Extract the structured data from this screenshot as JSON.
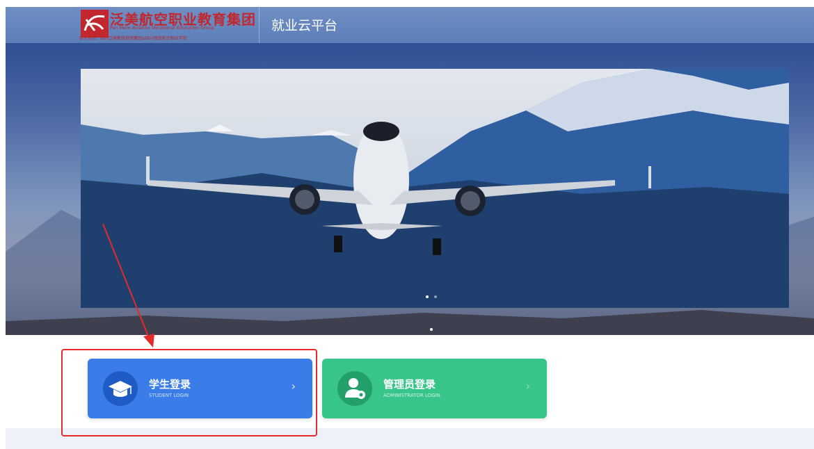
{
  "header": {
    "logo_title": "泛美航空职业教育集团",
    "logo_english": "Pan Mem Aviation Vocational Education Group",
    "logo_sub": "牵头单位：四川泛美教育投资集团&四川西南航空职业学院",
    "platform_title": "就业云平台"
  },
  "carousel": {
    "slide_count": 2,
    "active_index": 0
  },
  "login": {
    "student": {
      "title": "学生登录",
      "subtitle": "STUDENT LOGIN",
      "icon": "graduation-cap-icon"
    },
    "admin": {
      "title": "管理员登录",
      "subtitle": "ADMINISTRATOR LOGIN",
      "icon": "user-gear-icon"
    }
  },
  "annotation": {
    "color": "#e42a2a"
  },
  "colors": {
    "student_card": "#3a7de8",
    "admin_card": "#38c58a",
    "header": "#6f8fc4"
  }
}
